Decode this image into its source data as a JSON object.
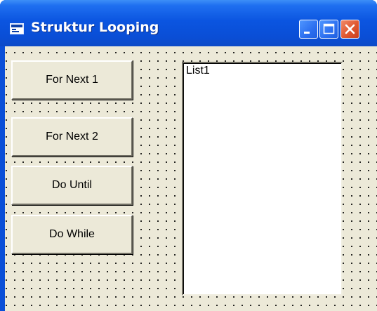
{
  "window": {
    "title": "Struktur Looping",
    "icon": "form-icon",
    "controls": [
      "minimize-icon",
      "maximize-icon",
      "close-icon"
    ]
  },
  "buttons": {
    "for_next_1": "For Next 1",
    "for_next_2": "For Next 2",
    "do_until": "Do Until",
    "do_while": "Do While"
  },
  "listbox": {
    "label": "List1"
  },
  "colors": {
    "titlebar": "#0b55e0",
    "client": "#ece9d8",
    "close": "#e0572f"
  }
}
